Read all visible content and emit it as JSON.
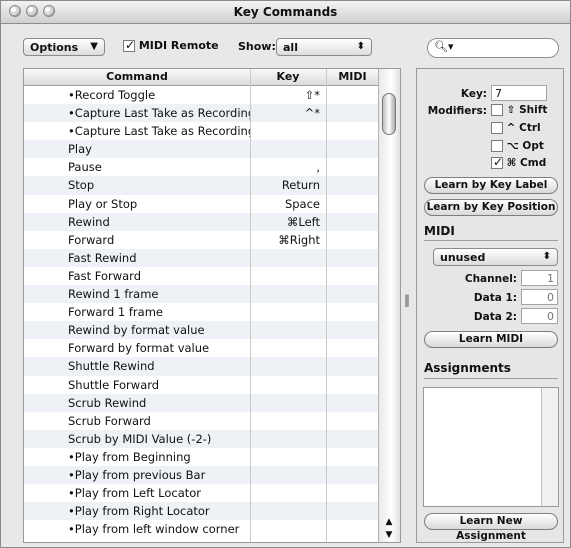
{
  "window": {
    "title": "Key Commands"
  },
  "toolbar": {
    "options_label": "Options",
    "options_arrow": "▼",
    "midi_remote_label": "MIDI Remote",
    "midi_remote_checked": true,
    "show_label": "Show:",
    "show_value": "all",
    "show_arrow": "⬍"
  },
  "search": {
    "icon": "search-icon",
    "glyph": "🔍︎▾"
  },
  "table": {
    "headers": {
      "command": "Command",
      "key": "Key",
      "midi": "MIDI"
    },
    "rows": [
      {
        "command": "•Record Toggle",
        "key": "⇧*",
        "midi": ""
      },
      {
        "command": "•Capture Last Take as Recording",
        "key": "^*",
        "midi": ""
      },
      {
        "command": "•Capture Last Take as Recording",
        "key": "",
        "midi": ""
      },
      {
        "command": "Play",
        "key": "",
        "midi": ""
      },
      {
        "command": "Pause",
        "key": ",",
        "midi": ""
      },
      {
        "command": "Stop",
        "key": "Return",
        "midi": ""
      },
      {
        "command": "Play or Stop",
        "key": "Space",
        "midi": ""
      },
      {
        "command": "Rewind",
        "key": "⌘Left",
        "midi": ""
      },
      {
        "command": "Forward",
        "key": "⌘Right",
        "midi": ""
      },
      {
        "command": "Fast Rewind",
        "key": "",
        "midi": ""
      },
      {
        "command": "Fast Forward",
        "key": "",
        "midi": ""
      },
      {
        "command": "Rewind 1 frame",
        "key": "",
        "midi": ""
      },
      {
        "command": "Forward 1 frame",
        "key": "",
        "midi": ""
      },
      {
        "command": "Rewind by format value",
        "key": "",
        "midi": ""
      },
      {
        "command": "Forward by format value",
        "key": "",
        "midi": ""
      },
      {
        "command": "Shuttle Rewind",
        "key": "",
        "midi": ""
      },
      {
        "command": "Shuttle Forward",
        "key": "",
        "midi": ""
      },
      {
        "command": "Scrub Rewind",
        "key": "",
        "midi": ""
      },
      {
        "command": "Scrub Forward",
        "key": "",
        "midi": ""
      },
      {
        "command": "Scrub by MIDI Value (-2-)",
        "key": "",
        "midi": ""
      },
      {
        "command": "•Play from Beginning",
        "key": "",
        "midi": ""
      },
      {
        "command": "•Play from previous Bar",
        "key": "",
        "midi": ""
      },
      {
        "command": "•Play from Left Locator",
        "key": "",
        "midi": ""
      },
      {
        "command": "•Play from Right Locator",
        "key": "",
        "midi": ""
      },
      {
        "command": "•Play from left window corner",
        "key": "",
        "midi": ""
      }
    ],
    "scroll_up": "▲",
    "scroll_down": "▼"
  },
  "splitter": {
    "glyph": "‖"
  },
  "panel": {
    "key_label": "Key:",
    "key_value": "7",
    "modifiers_label": "Modifiers:",
    "modifiers": [
      {
        "label": "⇧ Shift",
        "checked": false
      },
      {
        "label": "^ Ctrl",
        "checked": false
      },
      {
        "label": "⌥ Opt",
        "checked": false
      },
      {
        "label": "⌘ Cmd",
        "checked": true
      }
    ],
    "learn_key_label": "Learn by Key Label",
    "learn_key_position": "Learn by Key Position",
    "midi_section": "MIDI",
    "midi_type": "unused",
    "midi_type_arrow": "⬍",
    "channel_label": "Channel:",
    "channel_value": "1",
    "data1_label": "Data 1:",
    "data1_value": "0",
    "data2_label": "Data 2:",
    "data2_value": "0",
    "learn_midi": "Learn MIDI",
    "assignments_section": "Assignments",
    "learn_new_assignment": "Learn New Assignment"
  }
}
